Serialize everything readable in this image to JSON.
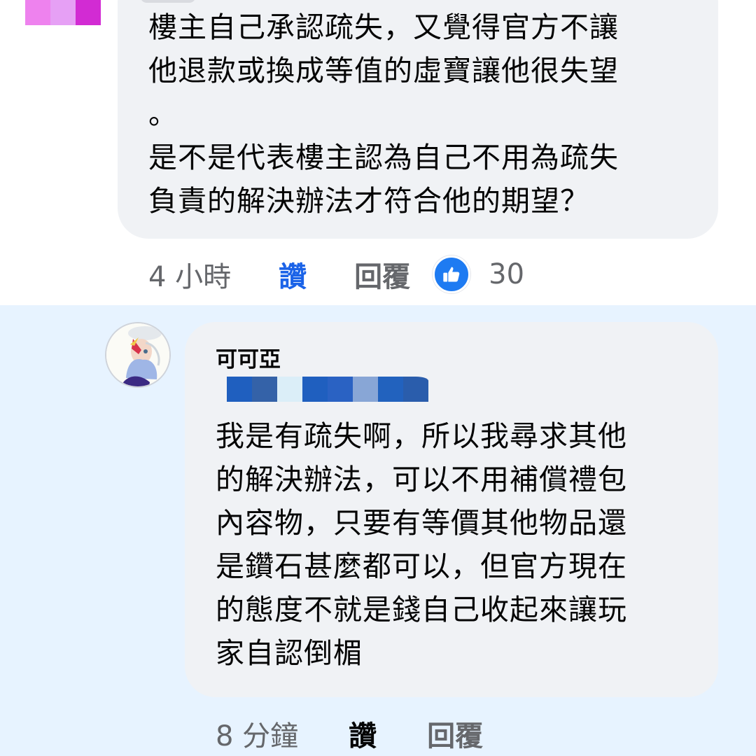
{
  "top_comment": {
    "text": "樓主自己承認疏失，又覺得官方不讓\n他退款或換成等值的虛寶讓他很失望\n。\n是不是代表樓主認為自己不用為疏失\n負責的解決辦法才符合他的期望？",
    "time": "4 小時",
    "like_label": "讚",
    "reply_label": "回覆",
    "reaction_icon": "like-thumb-icon",
    "reaction_count": "30",
    "like_label_color": "#1b63e8"
  },
  "reply": {
    "author": "可可亞",
    "text": "我是有疏失啊，所以我尋求其他\n的解決辦法，可以不用補償禮包\n內容物，只要有等價其他物品還\n是鑽石甚麼都可以，但官方現在\n的態度不就是錢自己收起來讓玩\n家自認倒楣",
    "time": "8 分鐘",
    "like_label": "讚",
    "reply_label": "回覆",
    "highlight_color": "#e7f3ff"
  },
  "colors": {
    "bubble": "#f0f2f5",
    "secondary_text": "#65676b",
    "reaction_blue": "#1e7bf2"
  }
}
